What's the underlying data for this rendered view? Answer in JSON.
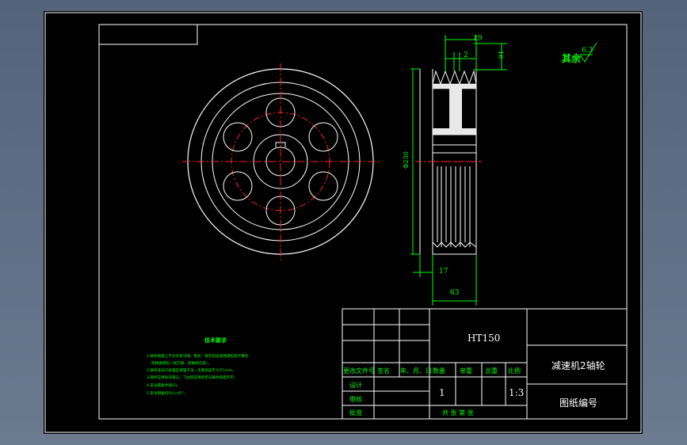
{
  "dimensions": {
    "d19": "19",
    "d2": "2",
    "d16": "16",
    "diameter": "Φ230",
    "d17": "17",
    "d63": "63"
  },
  "roughness": {
    "label": "其余",
    "value": "6.3"
  },
  "tech_requirements": {
    "title": "技术要求",
    "lines": [
      "1.铸件表面上不允许有冷隔、裂纹、缩孔和穿透性缺陷及严重的",
      "残缺类缺陷（如欠铸、机械损伤等）。",
      "2.铸件非加工表面应清理干净，毛刺高度不大于1mm。",
      "3.铸件应清除浇冒口，飞边等应清除至与铸件表面齐平。",
      "4.未注圆角半径R3。",
      "5.未注倒角均为1×45°。"
    ]
  },
  "title_block": {
    "material": "HT150",
    "part_name": "减速机2轴轮",
    "drawing_no_label": "图纸编号",
    "headers": [
      "更改文件号",
      "签名",
      "年、月、日",
      "数量",
      "单重",
      "总重",
      "比例"
    ],
    "rows": [
      "设计",
      "审核",
      "批准"
    ],
    "quantity": "1",
    "scale": "1:3",
    "sheet_footer": "共    张    第    张"
  }
}
